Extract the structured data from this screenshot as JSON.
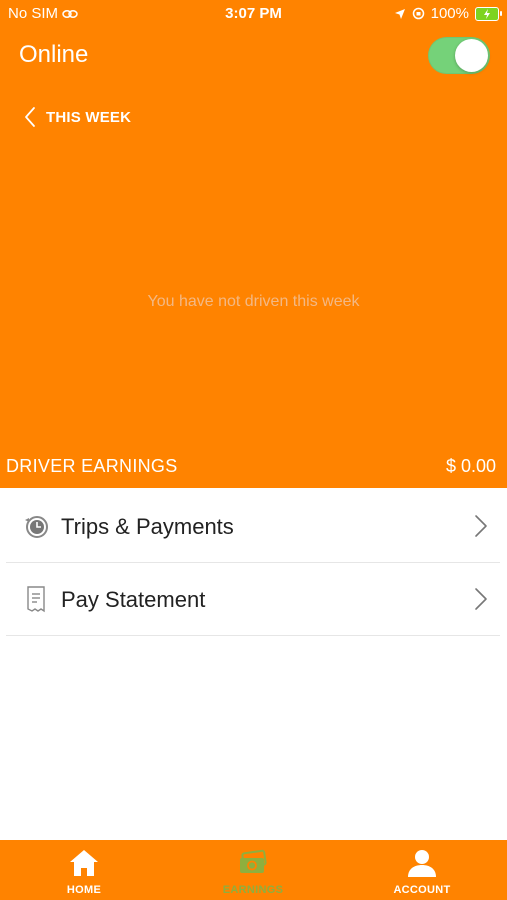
{
  "status_bar": {
    "carrier": "No SIM",
    "time": "3:07 PM",
    "battery": "100%"
  },
  "header": {
    "title": "Online",
    "toggle_on": true,
    "period_label": "THIS WEEK",
    "empty_message": "You have not driven this week",
    "earnings_label": "DRIVER EARNINGS",
    "earnings_amount": "$ 0.00"
  },
  "menu": {
    "items": [
      {
        "label": "Trips & Payments",
        "icon": "clock-history-icon"
      },
      {
        "label": "Pay Statement",
        "icon": "receipt-icon"
      }
    ]
  },
  "tabs": [
    {
      "label": "HOME",
      "icon": "home-icon",
      "active": false
    },
    {
      "label": "EARNINGS",
      "icon": "money-icon",
      "active": true
    },
    {
      "label": "ACCOUNT",
      "icon": "person-icon",
      "active": false
    }
  ],
  "colors": {
    "brand": "#FF8300",
    "toggle_on": "#75D279",
    "active_tab": "#8EAF3E"
  }
}
